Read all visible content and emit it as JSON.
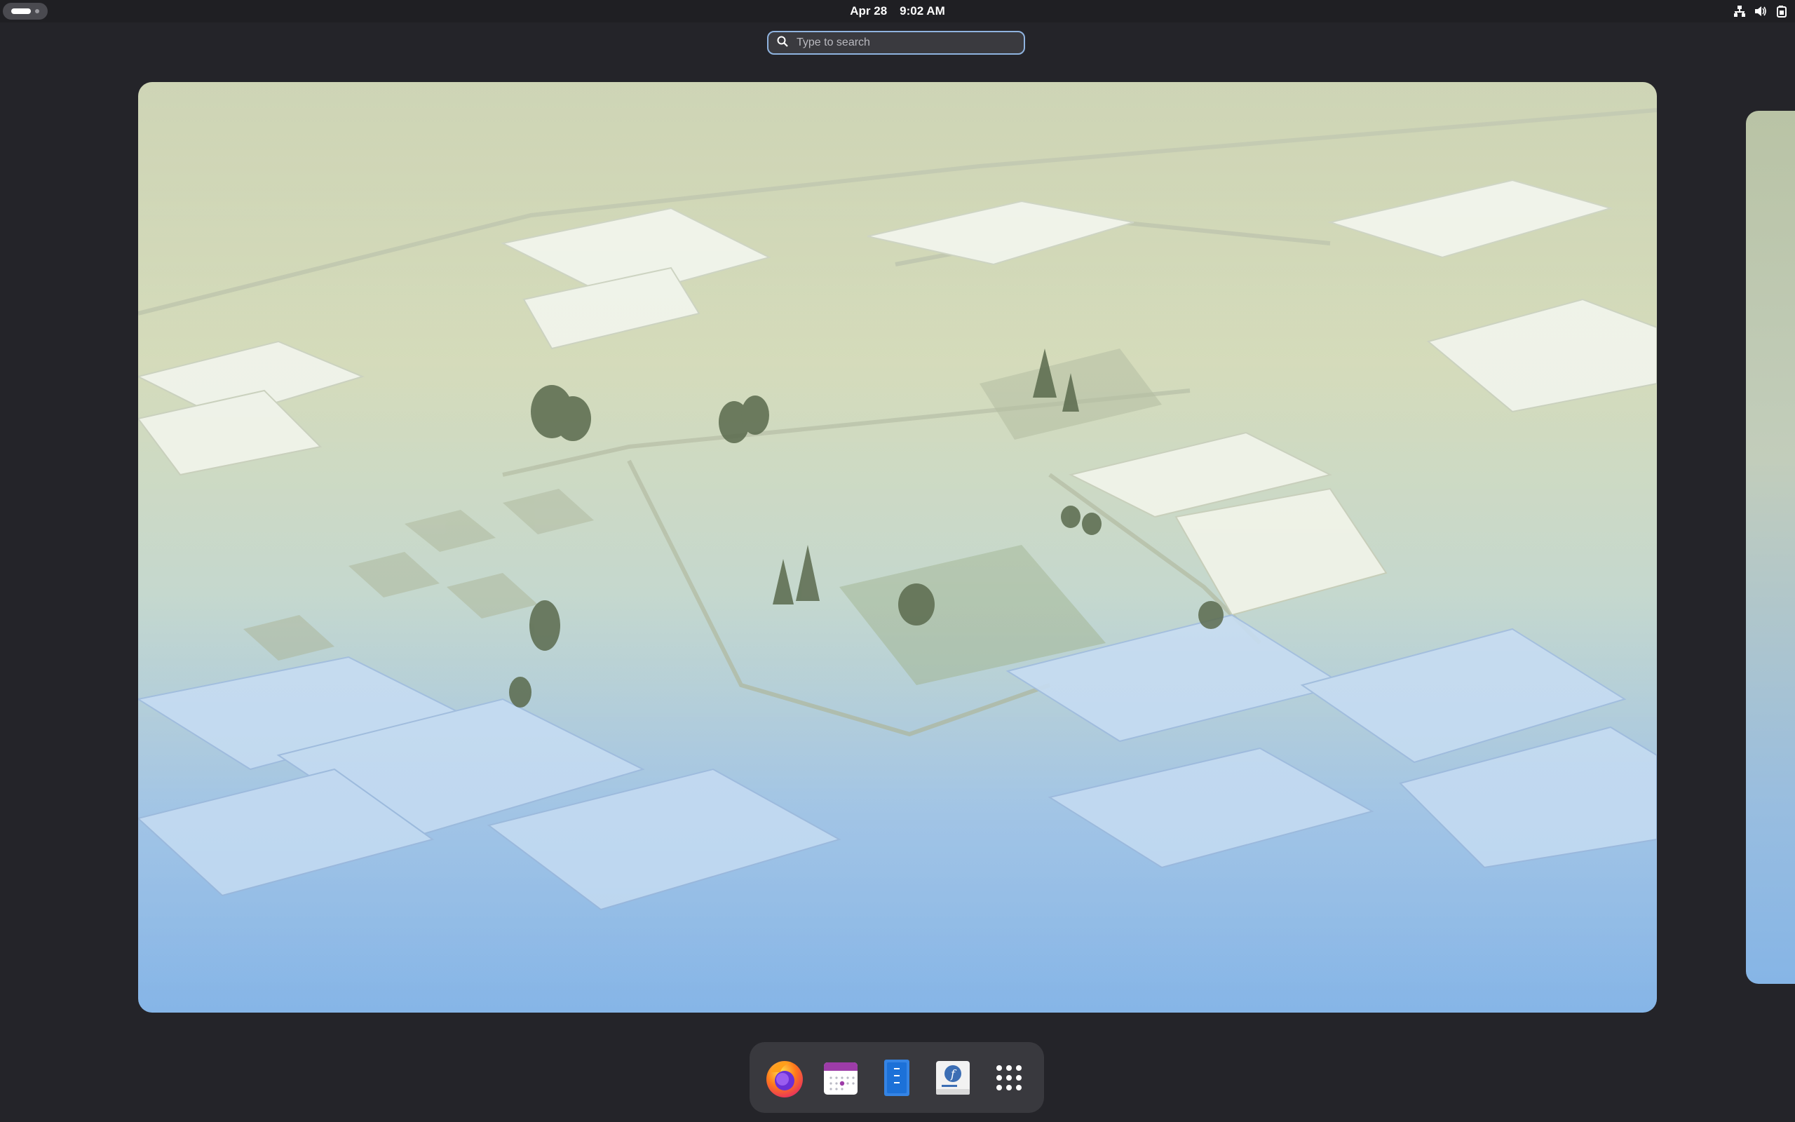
{
  "topbar": {
    "activities_icon": "workspace-indicator",
    "date": "Apr 28",
    "time": "9:02 AM",
    "tray_icons": [
      "network-icon",
      "volume-icon",
      "battery-icon"
    ]
  },
  "search": {
    "placeholder": "Type to search",
    "value": ""
  },
  "workspaces": {
    "current_wallpaper": "isometric-city-wallpaper",
    "next_workspace_peek": true
  },
  "dock": {
    "items": [
      {
        "name": "Firefox",
        "icon": "firefox-icon"
      },
      {
        "name": "Calendar",
        "icon": "calendar-icon"
      },
      {
        "name": "Text Editor",
        "icon": "text-editor-icon"
      },
      {
        "name": "Fedora Media Writer",
        "icon": "fedora-icon"
      },
      {
        "name": "Show Apps",
        "icon": "app-grid-icon"
      }
    ]
  },
  "colors": {
    "panel": "#1f1f23",
    "background": "#242429",
    "search_border": "#8fb3df",
    "dock": "#39393e"
  }
}
